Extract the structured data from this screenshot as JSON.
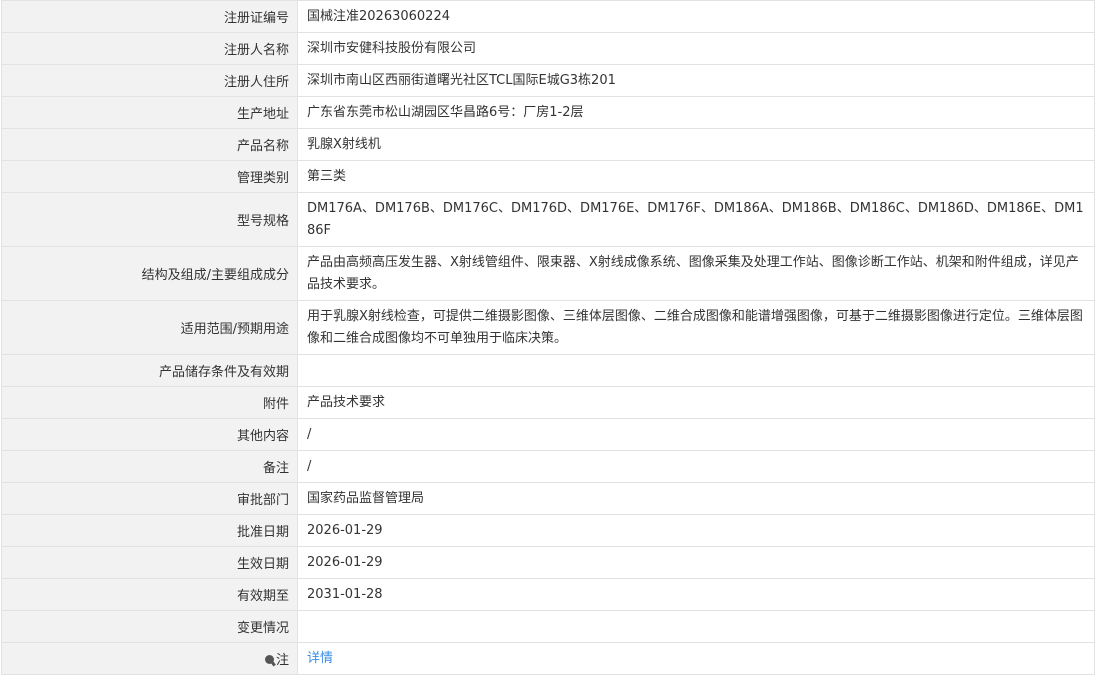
{
  "rows": [
    {
      "label": "注册证编号",
      "value": "国械注准20263060224"
    },
    {
      "label": "注册人名称",
      "value": "深圳市安健科技股份有限公司"
    },
    {
      "label": "注册人住所",
      "value": "深圳市南山区西丽街道曙光社区TCL国际E城G3栋201"
    },
    {
      "label": "生产地址",
      "value": "广东省东莞市松山湖园区华昌路6号：厂房1-2层"
    },
    {
      "label": "产品名称",
      "value": "乳腺X射线机"
    },
    {
      "label": "管理类别",
      "value": "第三类"
    },
    {
      "label": "型号规格",
      "value": "DM176A、DM176B、DM176C、DM176D、DM176E、DM176F、DM186A、DM186B、DM186C、DM186D、DM186E、DM186F"
    },
    {
      "label": "结构及组成/主要组成成分",
      "value": "产品由高频高压发生器、X射线管组件、限束器、X射线成像系统、图像采集及处理工作站、图像诊断工作站、机架和附件组成，详见产品技术要求。"
    },
    {
      "label": "适用范围/预期用途",
      "value": "用于乳腺X射线检查，可提供二维摄影图像、三维体层图像、二维合成图像和能谱增强图像，可基于二维摄影图像进行定位。三维体层图像和二维合成图像均不可单独用于临床决策。"
    },
    {
      "label": "产品储存条件及有效期",
      "value": ""
    },
    {
      "label": "附件",
      "value": "产品技术要求"
    },
    {
      "label": "其他内容",
      "value": "/"
    },
    {
      "label": "备注",
      "value": "/"
    },
    {
      "label": "审批部门",
      "value": "国家药品监督管理局"
    },
    {
      "label": "批准日期",
      "value": "2026-01-29"
    },
    {
      "label": "生效日期",
      "value": "2026-01-29"
    },
    {
      "label": "有效期至",
      "value": "2031-01-28"
    },
    {
      "label": "变更情况",
      "value": ""
    }
  ],
  "note_row": {
    "icon": "note-pin-icon",
    "label": "注",
    "link_text": "详情",
    "link_color": "#3a8ee6"
  }
}
